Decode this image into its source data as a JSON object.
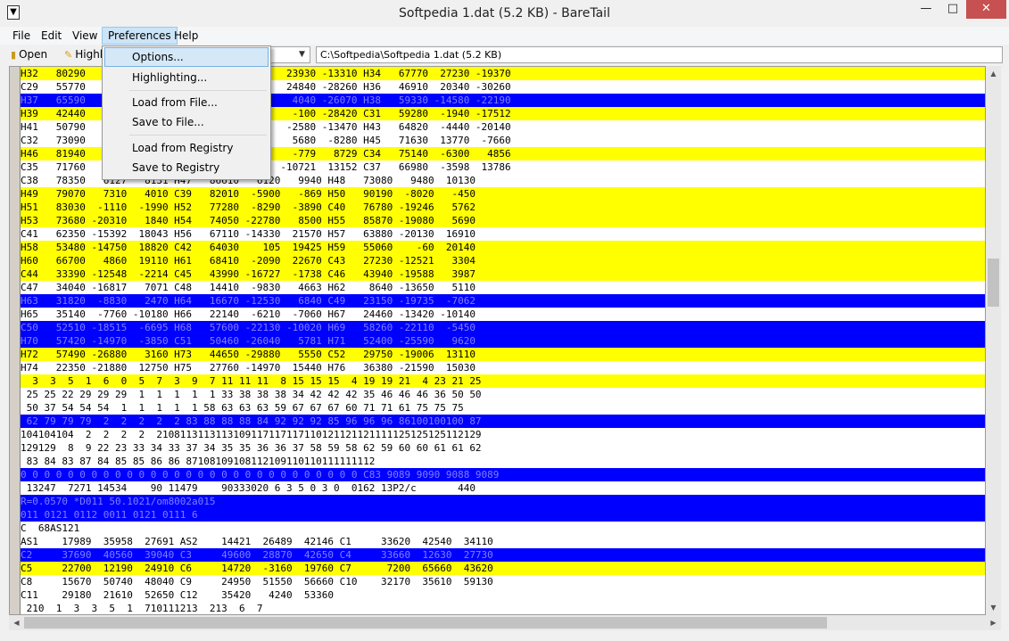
{
  "window": {
    "title": "Softpedia 1.dat (5.2 KB) - BareTail"
  },
  "titlebar": {
    "minimize": "—",
    "maximize": "□",
    "close": "✕"
  },
  "menubar": {
    "items": [
      "File",
      "Edit",
      "View",
      "Preferences",
      "Help"
    ]
  },
  "toolbar": {
    "open_label": "Open",
    "highlighting_label": "Highl",
    "file_path": "C:\\Softpedia\\Softpedia 1.dat (5.2 KB)"
  },
  "preferences_menu": {
    "items": [
      "Options...",
      "Highlighting...",
      "Load from File...",
      "Save to File...",
      "Load from Registry",
      "Save to Registry"
    ]
  },
  "colors": {
    "yellow": "#ffff00",
    "blue": "#0000ff",
    "close_red": "#c75050"
  },
  "log_lines": [
    {
      "text": "H32   80290                                  23930 -13310 H34   67770  27230 -19370",
      "hl": "yellow"
    },
    {
      "text": "C29   55770                                  24840 -28260 H36   46910  20340 -30260",
      "hl": "none"
    },
    {
      "text": "H37   65590                                   4040 -26070 H38   59330 -14580 -22190",
      "hl": "blue"
    },
    {
      "text": "H39   42440                                   -100 -28420 C31   59280  -1940 -17512",
      "hl": "yellow"
    },
    {
      "text": "H41   50790                                  -2580 -13470 H43   64820  -4440 -20140",
      "hl": "none"
    },
    {
      "text": "C32   73090                                   5680  -8280 H45   71630  13770  -7660",
      "hl": "none"
    },
    {
      "text": "H46   81940                                   -779   8729 C34   75140  -6300   4856",
      "hl": "yellow"
    },
    {
      "text": "C35   71760                                 -10721  13152 C37   66980  -3598  13786",
      "hl": "none"
    },
    {
      "text": "C38   78350   6127   8131 H47   86610   6120   9940 H48   73080   9480  10130",
      "hl": "none"
    },
    {
      "text": "H49   79070   7310   4010 C39   82010  -5900   -869 H50   90190  -8020   -450",
      "hl": "yellow"
    },
    {
      "text": "H51   83030  -1110  -1990 H52   77280  -8290  -3890 C40   76780 -19246   5762",
      "hl": "yellow"
    },
    {
      "text": "H53   73680 -20310   1840 H54   74050 -22780   8500 H55   85870 -19080   5690",
      "hl": "yellow"
    },
    {
      "text": "C41   62350 -15392  18043 H56   67110 -14330  21570 H57   63880 -20130  16910",
      "hl": "none"
    },
    {
      "text": "H58   53480 -14750  18820 C42   64030    105  19425 H59   55060    -60  20140",
      "hl": "yellow"
    },
    {
      "text": "H60   66700   4860  19110 H61   68410  -2090  22670 C43   27230 -12521   3304",
      "hl": "yellow"
    },
    {
      "text": "C44   33390 -12548  -2214 C45   43990 -16727  -1738 C46   43940 -19588   3987",
      "hl": "yellow"
    },
    {
      "text": "C47   34040 -16817   7071 C48   14410  -9830   4663 H62    8640 -13650   5110",
      "hl": "none"
    },
    {
      "text": "H63   31820  -8830   2470 H64   16670 -12530   6840 C49   23150 -19735  -7062",
      "hl": "blue"
    },
    {
      "text": "H65   35140  -7760 -10180 H66   22140  -6210  -7060 H67   24460 -13420 -10140",
      "hl": "none"
    },
    {
      "text": "C50   52510 -18515  -6695 H68   57600 -22130 -10020 H69   58260 -22110  -5450",
      "hl": "blue"
    },
    {
      "text": "H70   57420 -14970  -3850 C51   50460 -26040   5781 H71   52400 -25590   9620",
      "hl": "blue"
    },
    {
      "text": "H72   57490 -26880   3160 H73   44650 -29880   5550 C52   29750 -19006  13110",
      "hl": "yellow"
    },
    {
      "text": "H74   22350 -21880  12750 H75   27760 -14970  15440 H76   36380 -21590  15030",
      "hl": "none"
    },
    {
      "text": "  3  3  5  1  6  0  5  7  3  9  7 11 11 11  8 15 15 15  4 19 19 21  4 23 21 25",
      "hl": "yellow"
    },
    {
      "text": " 25 25 22 29 29 29  1  1  1  1  1 33 38 38 38 34 42 42 42 35 46 46 46 36 50 50",
      "hl": "none"
    },
    {
      "text": " 50 37 54 54 54  1  1  1  1  1 58 63 63 63 59 67 67 67 60 71 71 61 75 75 75",
      "hl": "none"
    },
    {
      "text": " 62 79 79 79  2  2  2  2  2 83 88 88 88 84 92 92 92 85 96 96 96 86100100100 87",
      "hl": "blue"
    },
    {
      "text": "104104104  2  2  2  2  2108113113113109117117117110121121121111125125125112129",
      "hl": "none"
    },
    {
      "text": "129129  8  9 22 23 33 34 33 37 34 35 35 36 36 37 58 59 58 62 59 60 60 61 61 62",
      "hl": "none"
    },
    {
      "text": " 83 84 83 87 84 85 85 86 86 87108109108112109110110111111112",
      "hl": "none"
    },
    {
      "text": "0 0 0 0 0 0 0 0 0 0 0 0 0 0 0 0 0 0 0 0 0 0 0 0 0 0 0 0 0 C83 9089 9090 9088 9089",
      "hl": "blue"
    },
    {
      "text": " 13247  7271 14534    90 11479    90333020 6 3 5 0 3 0  0162 13P2/c       440",
      "hl": "none"
    },
    {
      "text": "R=0.0570 *D011 50.1021/om8002a015",
      "hl": "blue"
    },
    {
      "text": "011 0121 0112 0011 0121 0111 6",
      "hl": "blue"
    },
    {
      "text": "C  68AS121",
      "hl": "none"
    },
    {
      "text": "AS1    17989  35958  27691 AS2    14421  26489  42146 C1     33620  42540  34110",
      "hl": "none"
    },
    {
      "text": "C2     37690  40560  39040 C3     49600  28870  42650 C4     33660  12630  27730",
      "hl": "blue"
    },
    {
      "text": "C5     22700  12190  24910 C6     14720  -3160  19760 C7      7200  65660  43620",
      "hl": "yellow"
    },
    {
      "text": "C8     15670  50740  48040 C9     24950  51550  56660 C10    32170  35610  59130",
      "hl": "none"
    },
    {
      "text": "C11    29180  21610  52650 C12    35420   4240  53360",
      "hl": "none"
    },
    {
      "text": " 210  1  3  3  5  1  710111213  213  6  7",
      "hl": "none"
    }
  ]
}
